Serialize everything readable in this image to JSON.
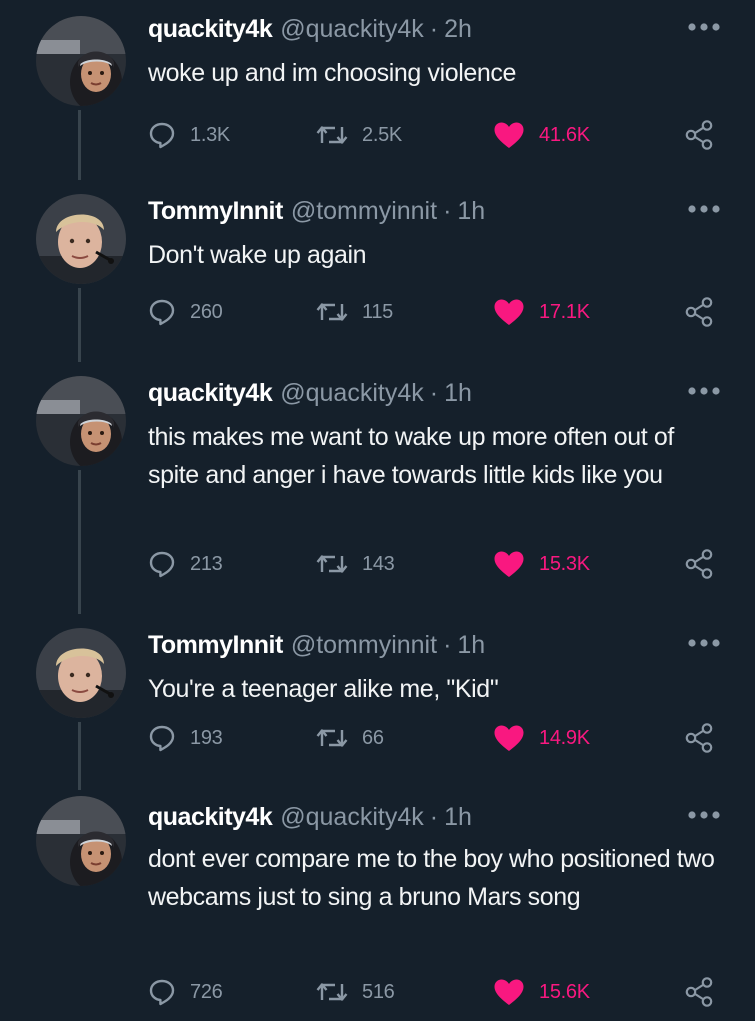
{
  "colors": {
    "background": "#15202b",
    "secondary_text": "#8b98a5",
    "like_pink": "#f91880",
    "thread_line": "#38444d"
  },
  "icons": {
    "reply": "speech-bubble-icon",
    "retweet": "retweet-arrows-icon",
    "like": "filled-heart-icon",
    "share": "share-nodes-icon",
    "more": "three-dots-icon"
  },
  "tweets": [
    {
      "name": "quackity4k",
      "handle": "@quackity4k",
      "dot": "·",
      "time": "2h",
      "text": "woke up and im choosing violence",
      "replies": "1.3K",
      "retweets": "2.5K",
      "likes": "41.6K"
    },
    {
      "name": "TommyInnit",
      "handle": "@tommyinnit",
      "dot": "·",
      "time": "1h",
      "text": "Don't wake up again",
      "replies": "260",
      "retweets": "115",
      "likes": "17.1K"
    },
    {
      "name": "quackity4k",
      "handle": "@quackity4k",
      "dot": "·",
      "time": "1h",
      "text": "this makes me want to wake up more often out of spite and anger i have towards little kids like you",
      "replies": "213",
      "retweets": "143",
      "likes": "15.3K"
    },
    {
      "name": "TommyInnit",
      "handle": "@tommyinnit",
      "dot": "·",
      "time": "1h",
      "text": "You're a teenager alike me, \"Kid\"",
      "replies": "193",
      "retweets": "66",
      "likes": "14.9K"
    },
    {
      "name": "quackity4k",
      "handle": "@quackity4k",
      "dot": "·",
      "time": "1h",
      "text": "dont ever compare me to the boy who positioned two webcams just to sing a bruno Mars song",
      "replies": "726",
      "retweets": "516",
      "likes": "15.6K"
    }
  ]
}
